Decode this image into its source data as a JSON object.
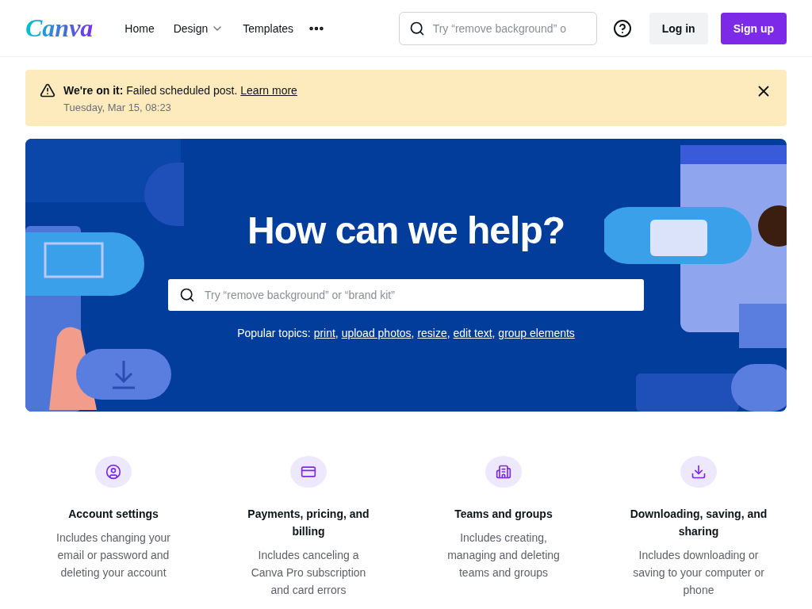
{
  "header": {
    "logo": "Canva",
    "nav": [
      {
        "label": "Home",
        "dropdown": false
      },
      {
        "label": "Design",
        "dropdown": true
      },
      {
        "label": "Templates",
        "dropdown": false
      }
    ],
    "search": {
      "placeholder": "Try “remove background” o"
    },
    "buttons": [
      {
        "label": "Log in",
        "kind": "secondary"
      },
      {
        "label": "Sign up",
        "kind": "primary"
      }
    ]
  },
  "notice": {
    "text": "**We're on it:** Failed scheduled post.",
    "link": "Learn more",
    "time": "Tuesday, Mar 15, 08:23"
  },
  "hero": {
    "title": "How can we help?",
    "search": {
      "placeholder": "Try “remove background” or “brand kit”"
    },
    "topics_label": "Popular topics:",
    "separator": ",",
    "topics": [
      "print",
      "upload photos",
      "resize",
      "edit text",
      "group elements"
    ]
  },
  "categories": [
    {
      "title": "Account settings",
      "description": "Includes changing your email or password and deleting your account"
    },
    {
      "title": "Payments, pricing, and billing",
      "description": "Includes canceling a Canva Pro subscription and card errors"
    },
    {
      "title": "Teams and groups",
      "description": "Includes creating, managing and deleting teams and groups"
    },
    {
      "title": "Downloading, saving, and sharing",
      "description": "Includes downloading or saving to your computer or phone"
    }
  ]
}
